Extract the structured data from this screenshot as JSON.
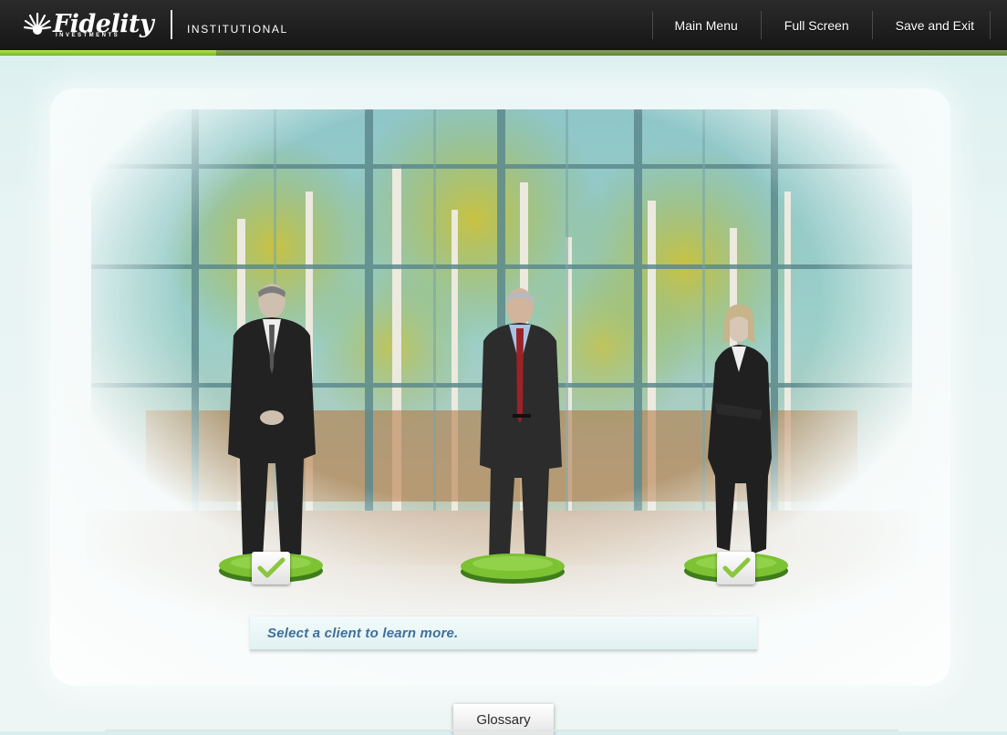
{
  "header": {
    "brand_name": "Fidelity",
    "brand_sub": "INVESTMENTS",
    "division": "INSTITUTIONAL",
    "nav": [
      "Main Menu",
      "Full Screen",
      "Save and Exit"
    ]
  },
  "progress": {
    "fraction": 0.215
  },
  "scene": {
    "clients": [
      {
        "id": "client-1",
        "completed": true
      },
      {
        "id": "client-2",
        "completed": false
      },
      {
        "id": "client-3",
        "completed": true
      }
    ],
    "prompt": "Select a client to learn more."
  },
  "footer": {
    "glossary_label": "Glossary"
  },
  "colors": {
    "topbar": "#1e1e1e",
    "progress_green": "#7cc232",
    "prompt_text": "#3e6f9c",
    "pedestal_green": "#6fb52a",
    "check_green": "#8cc63f"
  }
}
